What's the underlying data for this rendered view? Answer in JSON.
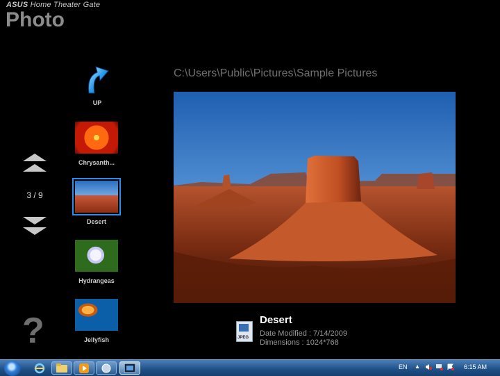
{
  "brand": {
    "maker": "ASUS",
    "product": "Home Theater Gate"
  },
  "app_title": "Photo",
  "path": "C:\\Users\\Public\\Pictures\\Sample Pictures",
  "navigation": {
    "counter": "3 / 9",
    "help": "?",
    "up_label": "UP"
  },
  "thumbnails": [
    {
      "label": "Chrysanth..."
    },
    {
      "label": "Desert",
      "selected": true
    },
    {
      "label": "Hydrangeas"
    },
    {
      "label": "Jellyfish"
    }
  ],
  "details": {
    "name": "Desert",
    "date_modified": "Date Modified : 7/14/2009",
    "dimensions": "Dimensions : 1024*768",
    "file_type": "JPEG"
  },
  "taskbar": {
    "language": "EN",
    "time": "6:15 AM",
    "pinned": [
      "ie-icon",
      "explorer-icon",
      "media-player-icon",
      "app-icon",
      "photo-app-icon"
    ]
  },
  "colors": {
    "selection": "#2d8cf0",
    "taskbar": "#1e4f85",
    "path_text": "#6f6f6f"
  }
}
